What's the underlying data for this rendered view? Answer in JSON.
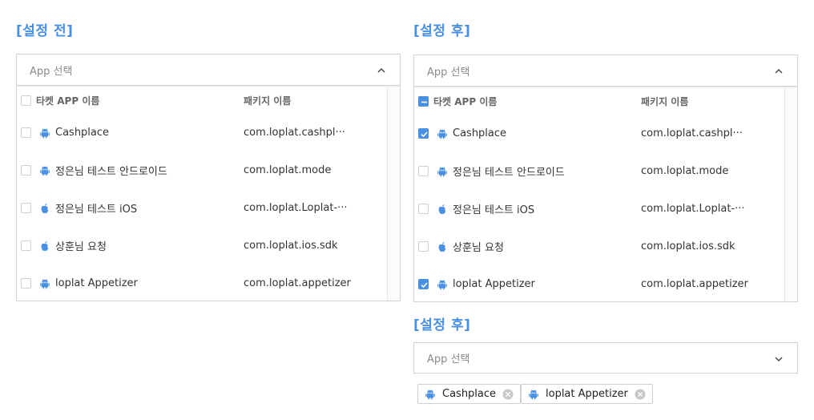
{
  "before": {
    "title": "[설정 전]",
    "select_placeholder": "App 선택",
    "header": {
      "name": "타켓 APP 이름",
      "package": "패키지 이름"
    },
    "rows": [
      {
        "name": "Cashplace",
        "package": "com.loplat.cashpl···",
        "platform": "android-icon",
        "checked": false
      },
      {
        "name": "정은님 테스트 안드로이드",
        "package": "com.loplat.mode",
        "platform": "android-icon",
        "checked": false
      },
      {
        "name": "정은님 테스트 iOS",
        "package": "com.loplat.Loplat-···",
        "platform": "apple-icon",
        "checked": false
      },
      {
        "name": "상훈님 요청",
        "package": "com.loplat.ios.sdk",
        "platform": "apple-icon",
        "checked": false
      },
      {
        "name": "loplat Appetizer",
        "package": "com.loplat.appetizer",
        "platform": "android-icon",
        "checked": false
      }
    ]
  },
  "after": {
    "title": "[설정 후]",
    "select_placeholder": "App 선택",
    "header": {
      "name": "타켓 APP 이름",
      "package": "패키지 이름"
    },
    "rows": [
      {
        "name": "Cashplace",
        "package": "com.loplat.cashpl···",
        "platform": "android-icon",
        "checked": true
      },
      {
        "name": "정은님 테스트 안드로이드",
        "package": "com.loplat.mode",
        "platform": "android-icon",
        "checked": false
      },
      {
        "name": "정은님 테스트 iOS",
        "package": "com.loplat.Loplat-···",
        "platform": "apple-icon",
        "checked": false
      },
      {
        "name": "상훈님 요청",
        "package": "com.loplat.ios.sdk",
        "platform": "apple-icon",
        "checked": false
      },
      {
        "name": "loplat Appetizer",
        "package": "com.loplat.appetizer",
        "platform": "android-icon",
        "checked": true
      }
    ]
  },
  "after_collapsed": {
    "title": "[설정 후]",
    "select_placeholder": "App 선택",
    "tags": [
      {
        "label": "Cashplace",
        "platform": "android-icon"
      },
      {
        "label": "loplat Appetizer",
        "platform": "android-icon"
      }
    ]
  },
  "colors": {
    "accent": "#4a90e2",
    "border": "#d4d4d4",
    "text": "#333333"
  }
}
